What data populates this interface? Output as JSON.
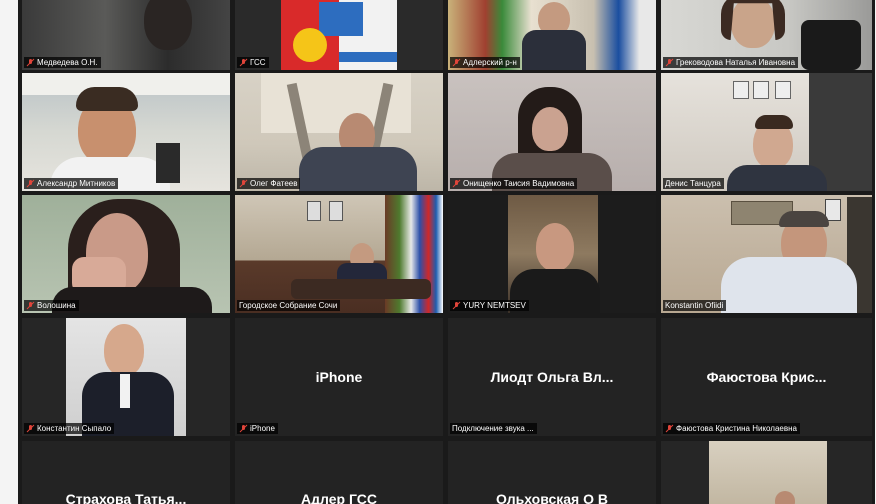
{
  "participants": [
    {
      "name": "Медведева О.Н.",
      "muted": true
    },
    {
      "name": "ГСС",
      "muted": true
    },
    {
      "name": "Адлерский р-н",
      "muted": true
    },
    {
      "name": "Греководова Наталья Ивановна",
      "muted": true
    },
    {
      "name": "Александр Митников",
      "muted": true
    },
    {
      "name": "Олег Фатеев",
      "muted": true
    },
    {
      "name": "Онищенко Таисия Вадимовна",
      "muted": true
    },
    {
      "name": "Денис Танцура",
      "muted": false
    },
    {
      "name": "Волошина",
      "muted": true
    },
    {
      "name": "Городское Собрание Сочи",
      "muted": false
    },
    {
      "name": "YURY NEMTSEV",
      "muted": true
    },
    {
      "name": "Konstantin Ofiidi",
      "muted": false,
      "active": true
    },
    {
      "name": "Константин Сыпало",
      "muted": true
    },
    {
      "name": "iPhone",
      "display_name": "iPhone",
      "muted": true
    },
    {
      "name": "Подключение звука ...",
      "display_name": "Лиодт  Ольга  Вл...",
      "muted": false
    },
    {
      "name": "Фаюстова Кристина Николаевна",
      "display_name": "Фаюстова  Крис...",
      "muted": true
    },
    {
      "display_name": "Страхова  Татья..."
    },
    {
      "display_name": "Адлер ГСС"
    },
    {
      "display_name": "Ольховская О В"
    },
    {}
  ],
  "colors": {
    "grid_bg": "#1a1a1a",
    "tile_bg": "#232323",
    "active_border": "#c9d86e",
    "muted_icon": "#e0453a"
  }
}
